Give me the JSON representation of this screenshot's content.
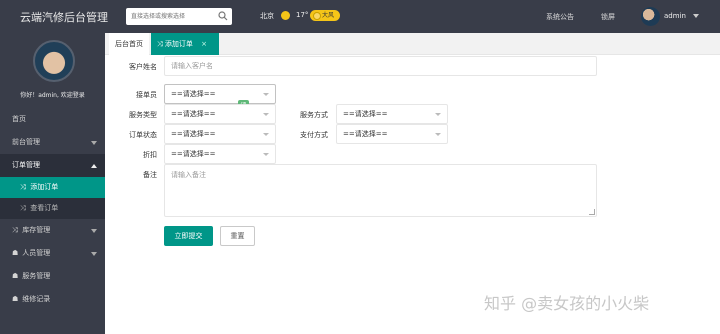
{
  "header": {
    "app_title": "云端汽修后台管理",
    "search": {
      "placeholder": "直接选择或搜索选择"
    },
    "weather": {
      "city": "北京",
      "temperature": "17°",
      "condition": "大风"
    },
    "links": {
      "announcement": "系统公告",
      "lock_screen": "锁屏"
    },
    "user": {
      "name": "admin"
    }
  },
  "sidebar": {
    "welcome": "你好！admin, 欢迎登录",
    "items": [
      {
        "label": "首页"
      },
      {
        "label": "前台管理"
      },
      {
        "label": "订单管理"
      },
      {
        "label": "库存管理"
      },
      {
        "label": "人员管理"
      },
      {
        "label": "服务管理"
      },
      {
        "label": "维修记录"
      }
    ],
    "order_submenu": [
      {
        "label": "添加订单"
      },
      {
        "label": "查看订单"
      }
    ]
  },
  "tabs": {
    "home": "后台首页",
    "active": "添加订单",
    "close": "×"
  },
  "form": {
    "customer_name": {
      "label": "客户姓名",
      "placeholder": "请输入客户名"
    },
    "receiver": {
      "label": "接单员",
      "value": "==请选择=="
    },
    "service_type": {
      "label": "服务类型",
      "value": "==请选择=="
    },
    "service_mode": {
      "label": "服务方式",
      "value": "==请选择=="
    },
    "order_status": {
      "label": "订单状态",
      "value": "==请选择=="
    },
    "payment_method": {
      "label": "支付方式",
      "value": "==请选择=="
    },
    "discount": {
      "label": "折扣",
      "value": "==请选择=="
    },
    "remark": {
      "label": "备注",
      "placeholder": "请输入备注"
    },
    "eval_badge": "评",
    "submit_label": "立即提交",
    "reset_label": "重置"
  },
  "watermark": "知乎 @卖女孩的小火柴",
  "colors": {
    "accent": "#009688",
    "topbar": "#393d49",
    "weather_badge": "#f5c518"
  }
}
